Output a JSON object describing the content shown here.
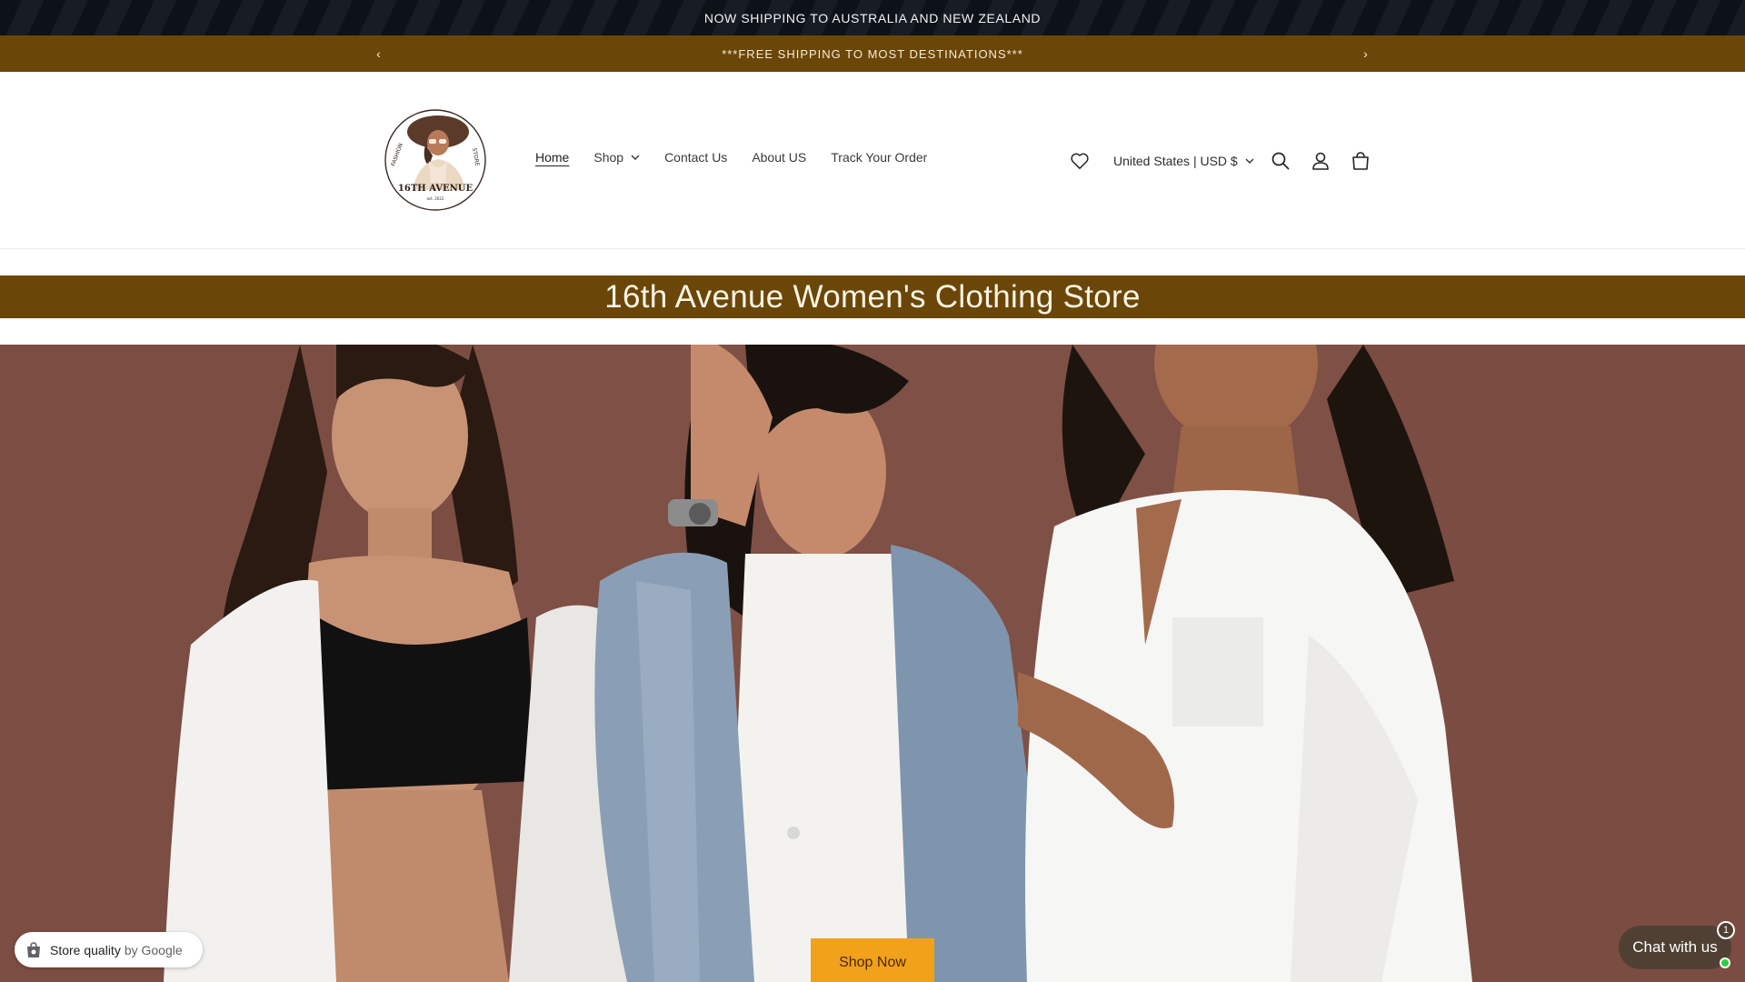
{
  "announcement": {
    "shipping_text": "NOW SHIPPING TO AUSTRALIA AND NEW ZEALAND",
    "promo_text": "***FREE SHIPPING TO MOST DESTINATIONS***"
  },
  "logo": {
    "brand_name": "16TH AVENUE",
    "left_text": "FASHION",
    "right_text": "STORE",
    "est": "est. 2022",
    "icon": "woman-with-hat-logo"
  },
  "nav": {
    "items": [
      {
        "label": "Home",
        "active": true
      },
      {
        "label": "Shop",
        "has_dropdown": true
      },
      {
        "label": "Contact Us"
      },
      {
        "label": "About US"
      },
      {
        "label": "Track Your Order"
      }
    ]
  },
  "header_tools": {
    "wishlist_icon": "heart-icon",
    "currency_label": "United States | USD $",
    "search_icon": "search-icon",
    "account_icon": "account-icon",
    "cart_icon": "cart-icon"
  },
  "title_band": {
    "title": "16th Avenue Women's Clothing Store"
  },
  "hero": {
    "image": "three women in white shirts and denim jacket against mauve wall",
    "cta_label": "Shop Now"
  },
  "google_badge": {
    "label": "Store quality",
    "suffix": "by Google"
  },
  "chat": {
    "label": "Chat with us",
    "unread_count": "1"
  },
  "colors": {
    "brand_brown": "#6b4609",
    "cta_orange": "#f2a11b",
    "chat_bg": "#4f4033",
    "hero_bg": "#7d4f45"
  }
}
